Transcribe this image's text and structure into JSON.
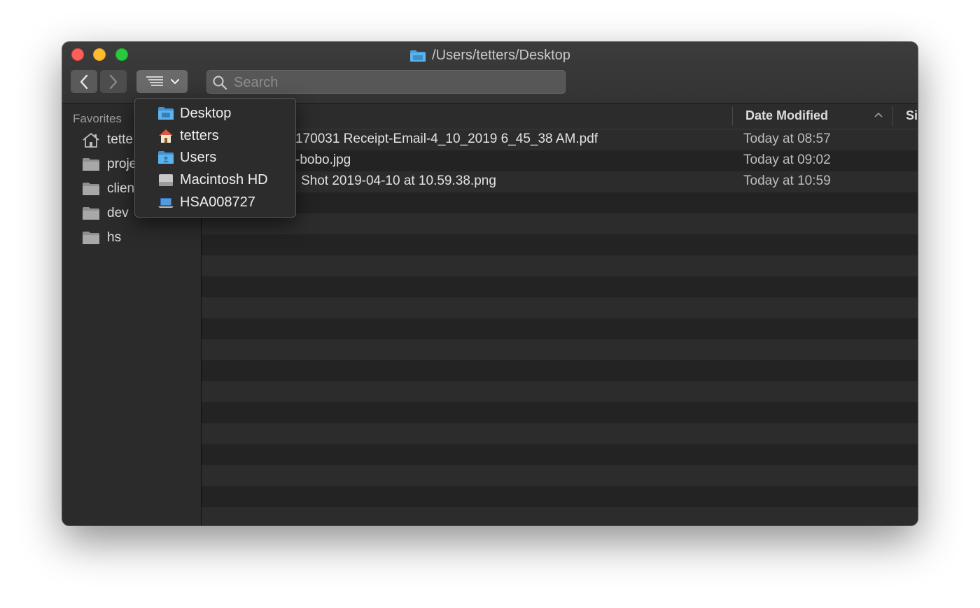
{
  "window": {
    "title": "/Users/tetters/Desktop",
    "title_icon": "folder-icon"
  },
  "toolbar": {
    "back_icon": "chevron-left-icon",
    "forward_icon": "chevron-right-icon",
    "path_icon": "list-path-icon",
    "search_placeholder": "Search",
    "search_value": ""
  },
  "sidebar": {
    "heading": "Favorites",
    "items": [
      {
        "label": "tette",
        "icon": "home-icon"
      },
      {
        "label": "proje",
        "icon": "folder-icon"
      },
      {
        "label": "clien",
        "icon": "folder-icon"
      },
      {
        "label": "dev",
        "icon": "folder-icon"
      },
      {
        "label": "hs",
        "icon": "folder-icon"
      }
    ]
  },
  "columns": {
    "date_modified": "Date Modified",
    "size_partial": "Si"
  },
  "files": [
    {
      "name": "170031 Receipt-Email-4_10_2019 6_45_38 AM.pdf",
      "date": "Today at 08:57"
    },
    {
      "name": "-bobo.jpg",
      "date": "Today at 09:02"
    },
    {
      "name": "Shot 2019-04-10 at 10.59.38.png",
      "date": "Today at 10:59"
    }
  ],
  "path_menu": {
    "items": [
      {
        "label": "Desktop",
        "icon": "desktop-folder-icon"
      },
      {
        "label": "tetters",
        "icon": "home-icon"
      },
      {
        "label": "Users",
        "icon": "users-folder-icon"
      },
      {
        "label": "Macintosh HD",
        "icon": "hard-drive-icon"
      },
      {
        "label": "HSA008727",
        "icon": "laptop-icon"
      }
    ]
  },
  "colors": {
    "close": "#fe5f57",
    "minimize": "#febc2e",
    "maximize": "#28c840",
    "folder_accent": "#4aa3df"
  }
}
